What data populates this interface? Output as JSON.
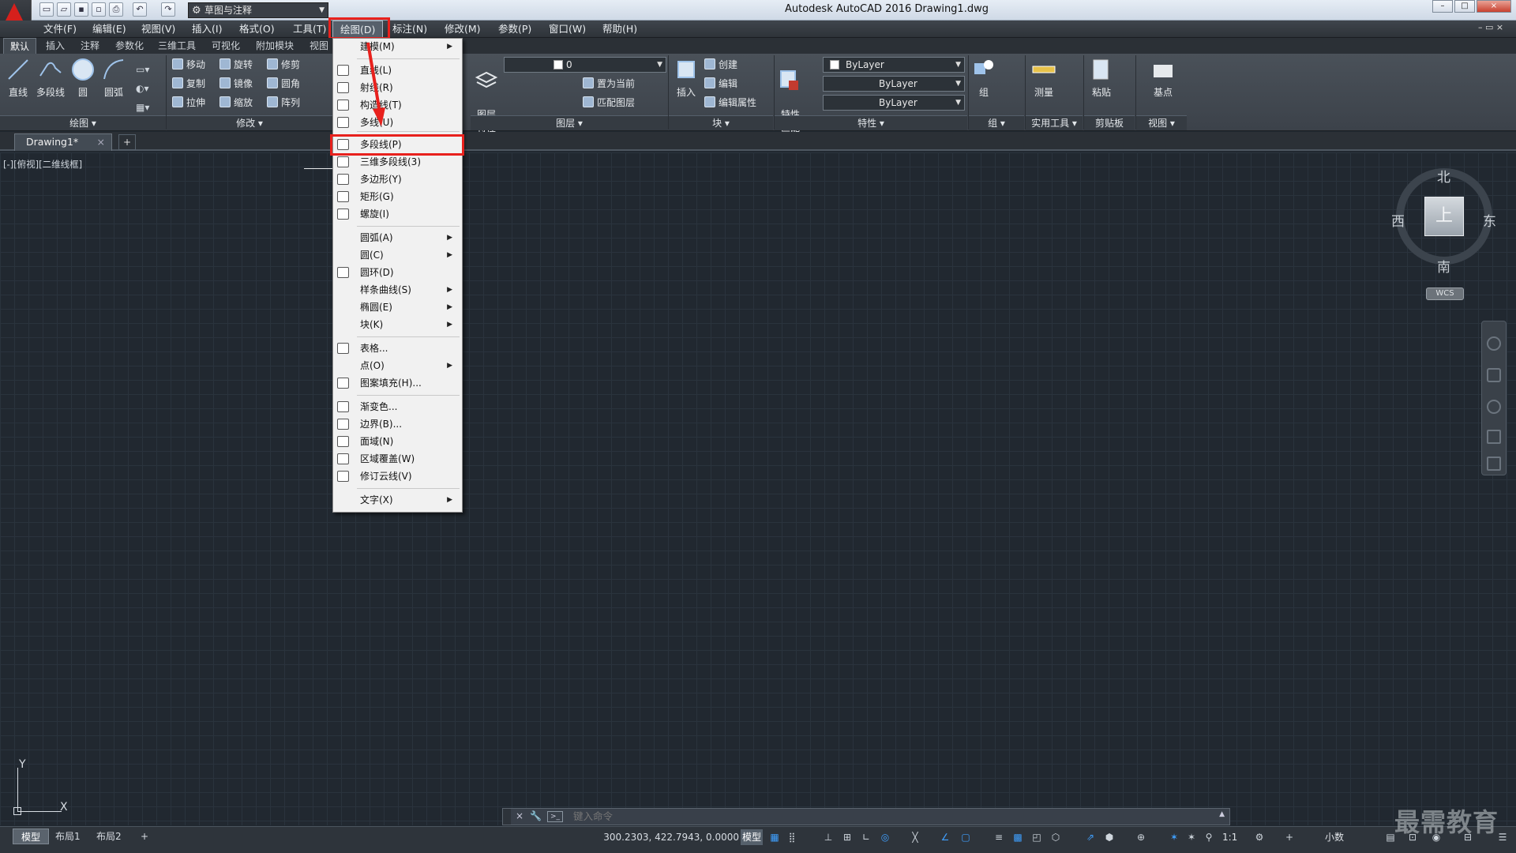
{
  "titlebar": {
    "workspace": "草图与注释",
    "title": "Autodesk AutoCAD 2016    Drawing1.dwg",
    "window_controls": [
      "–",
      "□",
      "×"
    ],
    "icons": [
      "new-icon",
      "open-icon",
      "save-icon",
      "save-as-icon",
      "print-icon",
      "undo-icon",
      "redo-icon"
    ]
  },
  "menubar": [
    "文件(F)",
    "编辑(E)",
    "视图(V)",
    "插入(I)",
    "格式(O)",
    "工具(T)",
    "绘图(D)",
    "标注(N)",
    "修改(M)",
    "参数(P)",
    "窗口(W)",
    "帮助(H)"
  ],
  "ribbon_tabs": [
    "默认",
    "插入",
    "注释",
    "参数化",
    "三维工具",
    "可视化",
    "附加模块",
    "视图"
  ],
  "ribbon": {
    "draw_panel": {
      "title": "绘图 ▾",
      "buttons": [
        "直线",
        "多段线",
        "圆",
        "圆弧"
      ]
    },
    "modify_panel": {
      "title": "修改 ▾",
      "rows": [
        [
          "移动",
          "旋转",
          "修剪"
        ],
        [
          "复制",
          "镜像",
          "圆角"
        ],
        [
          "拉伸",
          "缩放",
          "阵列"
        ]
      ]
    },
    "layer_panel": {
      "title": "图层 ▾",
      "big": "图层\n特性",
      "layer_value": "0",
      "rows": [
        "置为当前",
        "匹配图层"
      ]
    },
    "block_panel": {
      "title": "块 ▾",
      "big": "插入",
      "rows": [
        "创建",
        "编辑",
        "编辑属性"
      ]
    },
    "properties_panel": {
      "title": "特性 ▾",
      "big": "特性\n匹配",
      "color": "ByLayer",
      "linetype": "ByLayer",
      "lineweight": "ByLayer"
    },
    "group_panel": {
      "title": "组 ▾",
      "big": "组"
    },
    "utilities_panel": {
      "title": "实用工具 ▾",
      "big": "测量"
    },
    "clipboard_panel": {
      "title": "剪贴板",
      "big": "粘贴"
    },
    "view_panel": {
      "title": "视图 ▾",
      "big": "基点"
    }
  },
  "doc_tab": {
    "name": "Drawing1*",
    "close": "×",
    "add": "+"
  },
  "viewport_label": "[-][俯视][二维线框]",
  "viewcube": {
    "top": "上",
    "north": "北",
    "south": "南",
    "east": "东",
    "west": "西",
    "wcs": "WCS"
  },
  "draw_menu": {
    "items": [
      {
        "label": "建模(M)",
        "sub": true,
        "icon": ""
      },
      {
        "label": "直线(L)",
        "sub": false,
        "icon": "line-icon"
      },
      {
        "label": "射线(R)",
        "sub": false,
        "icon": "ray-icon"
      },
      {
        "label": "构造线(T)",
        "sub": false,
        "icon": "xline-icon"
      },
      {
        "label": "多线(U)",
        "sub": false,
        "icon": "mline-icon"
      },
      {
        "label": "多段线(P)",
        "sub": false,
        "icon": "polyline-icon"
      },
      {
        "label": "三维多段线(3)",
        "sub": false,
        "icon": "3dpoly-icon"
      },
      {
        "label": "多边形(Y)",
        "sub": false,
        "icon": "polygon-icon"
      },
      {
        "label": "矩形(G)",
        "sub": false,
        "icon": "rectangle-icon"
      },
      {
        "label": "螺旋(I)",
        "sub": false,
        "icon": "helix-icon"
      },
      {
        "label": "圆弧(A)",
        "sub": true,
        "icon": ""
      },
      {
        "label": "圆(C)",
        "sub": true,
        "icon": ""
      },
      {
        "label": "圆环(D)",
        "sub": false,
        "icon": "donut-icon"
      },
      {
        "label": "样条曲线(S)",
        "sub": true,
        "icon": ""
      },
      {
        "label": "椭圆(E)",
        "sub": true,
        "icon": ""
      },
      {
        "label": "块(K)",
        "sub": true,
        "icon": ""
      },
      {
        "label": "表格...",
        "sub": false,
        "icon": "table-icon"
      },
      {
        "label": "点(O)",
        "sub": true,
        "icon": ""
      },
      {
        "label": "图案填充(H)...",
        "sub": false,
        "icon": "hatch-icon"
      },
      {
        "label": "渐变色...",
        "sub": false,
        "icon": "gradient-icon"
      },
      {
        "label": "边界(B)...",
        "sub": false,
        "icon": "boundary-icon"
      },
      {
        "label": "面域(N)",
        "sub": false,
        "icon": "region-icon"
      },
      {
        "label": "区域覆盖(W)",
        "sub": false,
        "icon": "wipeout-icon"
      },
      {
        "label": "修订云线(V)",
        "sub": false,
        "icon": "revcloud-icon"
      },
      {
        "label": "文字(X)",
        "sub": true,
        "icon": ""
      }
    ],
    "highlighted": "多段线(P)"
  },
  "command_line": {
    "placeholder": "键入命令"
  },
  "status": {
    "layouts": [
      "模型",
      "布局1",
      "布局2"
    ],
    "add": "+",
    "coords": "300.2303, 422.7943, 0.0000",
    "model": "模型",
    "scale": "1:1",
    "units": "小数"
  },
  "watermark": "最需教育",
  "colors": {
    "accent_red": "#e8211d",
    "canvas": "#212830",
    "autocad_red": "#d6201c"
  }
}
